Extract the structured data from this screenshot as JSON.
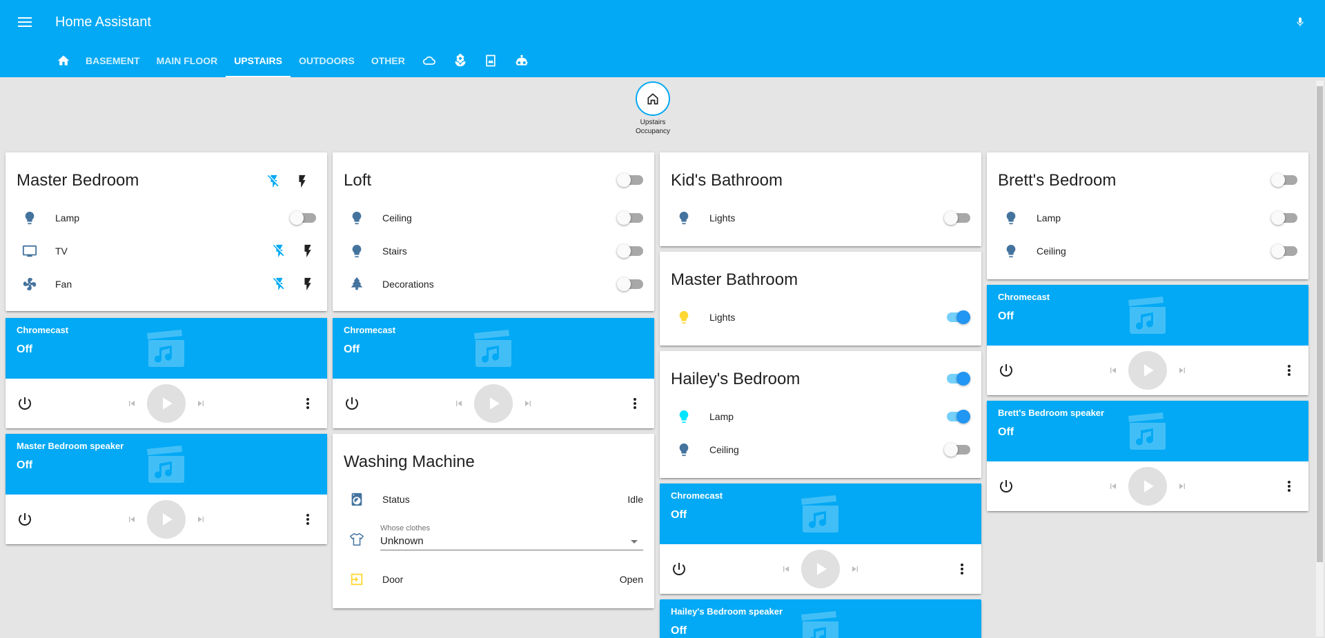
{
  "header": {
    "title": "Home Assistant",
    "menu_icon": "menu-icon",
    "mic_icon": "microphone-icon"
  },
  "tabs": [
    {
      "kind": "icon",
      "icon": "home-icon"
    },
    {
      "kind": "text",
      "label": "BASEMENT"
    },
    {
      "kind": "text",
      "label": "MAIN FLOOR"
    },
    {
      "kind": "text",
      "label": "UPSTAIRS",
      "active": true
    },
    {
      "kind": "text",
      "label": "OUTDOORS"
    },
    {
      "kind": "text",
      "label": "OTHER"
    },
    {
      "kind": "icon",
      "icon": "cloud-icon"
    },
    {
      "kind": "icon",
      "icon": "flower-icon"
    },
    {
      "kind": "icon",
      "icon": "image-frame-icon"
    },
    {
      "kind": "icon",
      "icon": "robot-icon"
    }
  ],
  "occupancy": {
    "label": "Upstairs Occupancy",
    "icon": "home-outline-icon"
  },
  "colors": {
    "primary": "#03a9f4",
    "icon_blue": "#44739e",
    "yellow": "#fdd835",
    "cyan": "#00e5ff",
    "toggle_on": "#2196f3"
  },
  "master_bedroom": {
    "title": "Master Bedroom",
    "rows": [
      {
        "label": "Lamp",
        "icon": "lightbulb-icon",
        "control": "toggle",
        "on": false
      },
      {
        "label": "TV",
        "icon": "television-icon",
        "control": "bolts"
      },
      {
        "label": "Fan",
        "icon": "fan-icon",
        "control": "bolts"
      }
    ]
  },
  "loft": {
    "title": "Loft",
    "header_toggle_on": false,
    "rows": [
      {
        "label": "Ceiling",
        "icon": "lightbulb-icon",
        "on": false
      },
      {
        "label": "Stairs",
        "icon": "lightbulb-icon",
        "on": false
      },
      {
        "label": "Decorations",
        "icon": "pine-tree-icon",
        "on": false
      }
    ]
  },
  "kids_bathroom": {
    "title": "Kid's Bathroom",
    "rows": [
      {
        "label": "Lights",
        "icon": "lightbulb-icon",
        "on": false
      }
    ]
  },
  "master_bathroom": {
    "title": "Master Bathroom",
    "rows": [
      {
        "label": "Lights",
        "icon": "lightbulb-icon",
        "on": true
      }
    ]
  },
  "haileys_bedroom": {
    "title": "Hailey's Bedroom",
    "header_toggle_on": true,
    "rows": [
      {
        "label": "Lamp",
        "icon": "lightbulb-icon",
        "on": true
      },
      {
        "label": "Ceiling",
        "icon": "lightbulb-icon",
        "on": false
      }
    ]
  },
  "bretts_bedroom": {
    "title": "Brett's Bedroom",
    "header_toggle_on": false,
    "rows": [
      {
        "label": "Lamp",
        "icon": "lightbulb-icon",
        "on": false
      },
      {
        "label": "Ceiling",
        "icon": "lightbulb-icon",
        "on": false
      }
    ]
  },
  "washing_machine": {
    "title": "Washing Machine",
    "status_label": "Status",
    "status_value": "Idle",
    "clothes_label": "Whose clothes",
    "clothes_value": "Unknown",
    "door_label": "Door",
    "door_value": "Open"
  },
  "media": {
    "mb_chromecast": {
      "name": "Chromecast",
      "state": "Off"
    },
    "mb_speaker": {
      "name": "Master Bedroom speaker",
      "state": "Off"
    },
    "loft_chromecast": {
      "name": "Chromecast",
      "state": "Off"
    },
    "hailey_chromecast": {
      "name": "Chromecast",
      "state": "Off"
    },
    "hailey_speaker": {
      "name": "Hailey's Bedroom speaker",
      "state": "Off"
    },
    "brett_chromecast": {
      "name": "Chromecast",
      "state": "Off"
    },
    "brett_speaker": {
      "name": "Brett's Bedroom speaker",
      "state": "Off"
    }
  }
}
